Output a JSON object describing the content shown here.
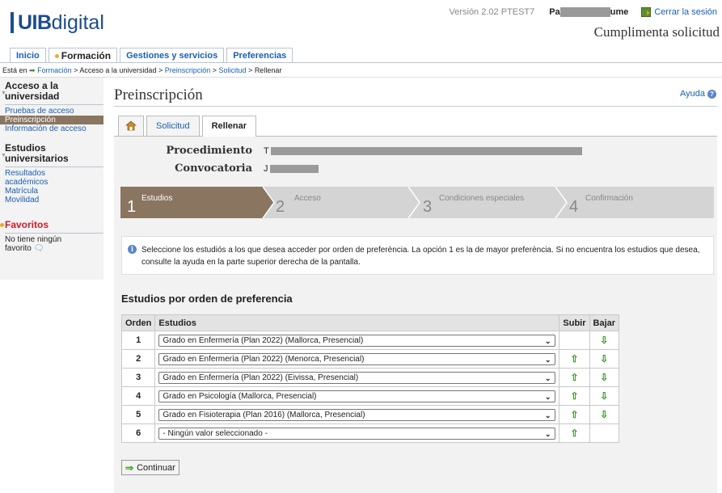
{
  "header": {
    "logo_bold": "UIB",
    "logo_rest": "digital",
    "version": "Versión 2.02 PTEST7",
    "user_prefix": "Pa",
    "user_suffix": "ume",
    "logout": "Cerrar la sesión",
    "page_heading": "Cumplimenta solicitud"
  },
  "topnav": [
    {
      "label": "Inicio"
    },
    {
      "label": "Formación"
    },
    {
      "label": "Gestiones y servicios"
    },
    {
      "label": "Preferencias"
    }
  ],
  "breadcrumb": {
    "prefix": "Está en",
    "items": [
      "Formación",
      "Acceso a la universidad",
      "Preinscripción",
      "Solicitud",
      "Rellenar"
    ]
  },
  "sidebar": {
    "sections": [
      {
        "title": "Acceso a la universidad",
        "items": [
          "Pruebas de acceso",
          "Preinscripción",
          "Información de acceso"
        ]
      },
      {
        "title": "Estudios universitarios",
        "items": [
          "Resultados académicos",
          "Matrícula",
          "Movilidad"
        ]
      }
    ],
    "favorites_title": "Favoritos",
    "favorites_empty": "No tiene ningún favorito"
  },
  "main": {
    "title": "Preinscripción",
    "help": "Ayuda",
    "tabs": [
      {
        "label": "Solicitud"
      },
      {
        "label": "Rellenar"
      }
    ],
    "procedimiento_label": "Procedimiento",
    "procedimiento_value": "T",
    "convocatoria_label": "Convocatoria",
    "convocatoria_value": "J"
  },
  "steps": [
    {
      "num": "1",
      "label": "Estudios",
      "active": true
    },
    {
      "num": "2",
      "label": "Acceso",
      "active": false
    },
    {
      "num": "3",
      "label": "Condiciones especiales",
      "active": false
    },
    {
      "num": "4",
      "label": "Confirmación",
      "active": false
    }
  ],
  "info_text": "Seleccione los estudiós a los que desea acceder por orden de preferència. La opción 1 es la de mayor preferència. Si no encuentra los estudios que desea, consulte la ayuda en la parte superior derecha de la pantalla.",
  "list_title": "Estudios por orden de preferencia",
  "table": {
    "headers": {
      "orden": "Orden",
      "estudios": "Estudios",
      "subir": "Subir",
      "bajar": "Bajar"
    },
    "rows": [
      {
        "orden": "1",
        "estudio": "Grado en Enfermería (Plan 2022) (Mallorca, Presencial)",
        "up": false,
        "down": true
      },
      {
        "orden": "2",
        "estudio": "Grado en Enfermería (Plan 2022) (Menorca, Presencial)",
        "up": true,
        "down": true
      },
      {
        "orden": "3",
        "estudio": "Grado en Enfermería (Plan 2022) (Eivissa, Presencial)",
        "up": true,
        "down": true
      },
      {
        "orden": "4",
        "estudio": "Grado en Psicología (Mallorca, Presencial)",
        "up": true,
        "down": true
      },
      {
        "orden": "5",
        "estudio": "Grado en Fisioterapia (Plan 2016) (Mallorca, Presencial)",
        "up": true,
        "down": true
      },
      {
        "orden": "6",
        "estudio": "- Ningún valor seleccionado -",
        "up": true,
        "down": false
      }
    ]
  },
  "continue_label": "Continuar",
  "colors": {
    "brand": "#1b4c8c",
    "step_active": "#8a7560",
    "step_inactive": "#d4d4d4",
    "arrow_green": "#3c9a2a"
  }
}
